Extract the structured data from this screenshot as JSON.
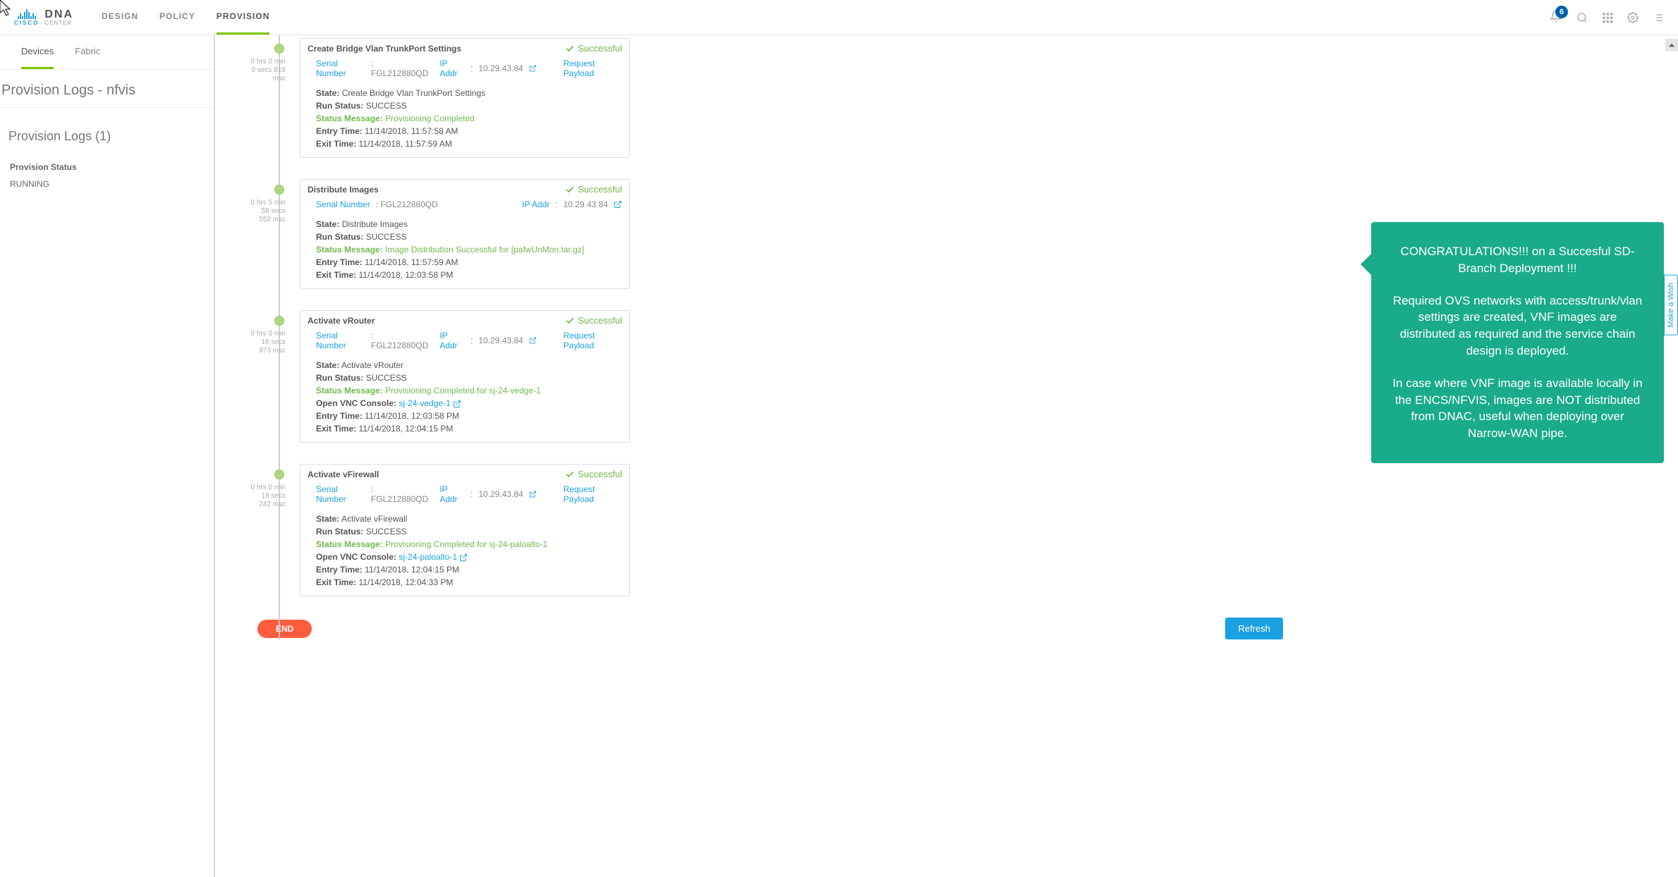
{
  "brand": {
    "cisco": "CISCO",
    "dna": "DNA",
    "center": "CENTER"
  },
  "nav": {
    "design": "DESIGN",
    "policy": "POLICY",
    "provision": "PROVISION"
  },
  "topbar": {
    "badge": "6"
  },
  "tabs": {
    "devices": "Devices",
    "fabric": "Fabric"
  },
  "side": {
    "title": "Provision Logs - nfvis",
    "subtitle": "Provision Logs (1)",
    "status_label": "Provision Status",
    "status_value": "RUNNING"
  },
  "labels": {
    "serial": "Serial Number",
    "ipaddr": "IP Addr",
    "request_payload": "Request Payload",
    "state": "State:",
    "run_status": "Run Status:",
    "status_message": "Status Message:",
    "entry_time": "Entry Time:",
    "exit_time": "Exit Time:",
    "open_vnc": "Open VNC Console:",
    "successful": "Successful"
  },
  "steps": [
    {
      "title": "Create Bridge Vlan TrunkPort Settings",
      "timing": [
        "0 hrs 0 min",
        "0 secs 819",
        "msc"
      ],
      "serial": "FGL212880QD",
      "ip": "10.29.43.84",
      "payload": true,
      "state": "Create Bridge Vlan TrunkPort Settings",
      "run": "SUCCESS",
      "msg": "Provisioning Completed",
      "entry": "11/14/2018, 11:57:58 AM",
      "exit": "11/14/2018, 11:57:59 AM"
    },
    {
      "title": "Distribute Images",
      "timing": [
        "0 hrs 5 min",
        "58 secs",
        "552 msc"
      ],
      "serial": "FGL212880QD",
      "ip": "10.29.43.84",
      "payload": false,
      "state": "Distribute Images",
      "run": "SUCCESS",
      "msg": "Image Distribution Successful for [pafwUnMon.tar.gz]",
      "entry": "11/14/2018, 11:57:59 AM",
      "exit": "11/14/2018, 12:03:58 PM"
    },
    {
      "title": "Activate vRouter",
      "timing": [
        "0 hrs 0 min",
        "16 secs",
        "873 msc"
      ],
      "serial": "FGL212880QD",
      "ip": "10.29.43.84",
      "payload": true,
      "state": "Activate vRouter",
      "run": "SUCCESS",
      "msg": "Provisioning Completed for sj-24-vedge-1",
      "vnc": "sj-24-vedge-1",
      "entry": "11/14/2018, 12:03:58 PM",
      "exit": "11/14/2018, 12:04:15 PM"
    },
    {
      "title": "Activate vFirewall",
      "timing": [
        "0 hrs 0 min",
        "18 secs",
        "242 msc"
      ],
      "serial": "FGL212880QD",
      "ip": "10.29.43.84",
      "payload": true,
      "state": "Activate vFirewall",
      "run": "SUCCESS",
      "msg": "Provisioning Completed for sj-24-paloalto-1",
      "vnc": "sj-24-paloalto-1",
      "entry": "11/14/2018, 12:04:15 PM",
      "exit": "11/14/2018, 12:04:33 PM"
    }
  ],
  "buttons": {
    "end": "END",
    "refresh": "Refresh"
  },
  "callout": {
    "p1": "CONGRATULATIONS!!! on a Succesful SD-Branch Deployment !!!",
    "p2": "Required OVS networks with access/trunk/vlan settings are created, VNF images are distributed as required and the service chain design is deployed.",
    "p3": "In case where VNF image is available locally in the ENCS/NFVIS, images are NOT distributed from DNAC, useful when deploying over Narrow-WAN pipe."
  },
  "wish": "Make a Wish"
}
